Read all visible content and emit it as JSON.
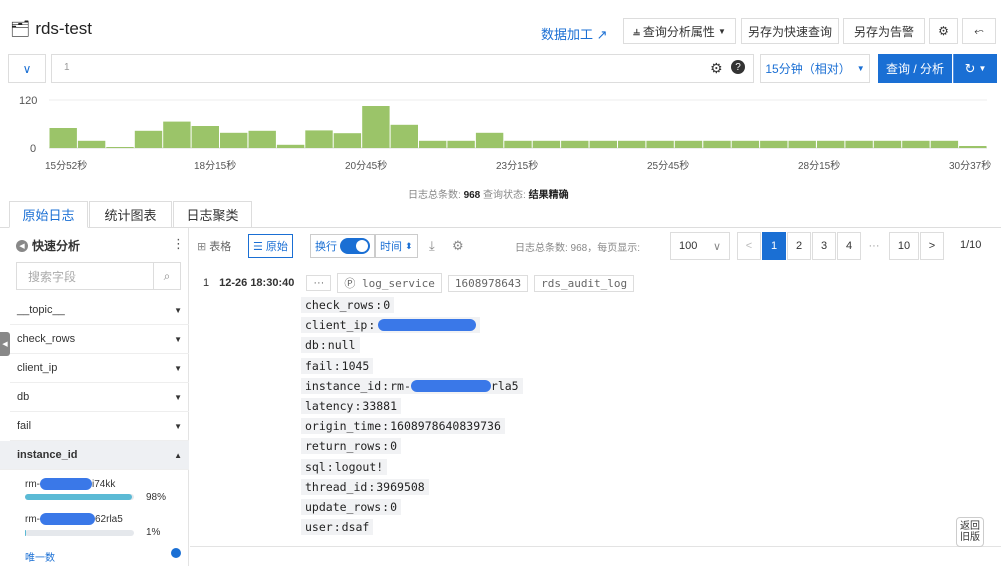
{
  "header": {
    "title": "rds-test",
    "data_processing": "数据加工",
    "query_props": "查询分析属性",
    "save_quick": "另存为快速查询",
    "save_alert": "另存为告警"
  },
  "query": {
    "line_number": "1",
    "time_range": "15分钟（相对）",
    "query_button": "查询 / 分析"
  },
  "chart_data": {
    "type": "bar",
    "ylim": [
      0,
      120
    ],
    "yticks": [
      "120",
      "0"
    ],
    "xticks": [
      "15分52秒",
      "18分15秒",
      "20分45秒",
      "23分15秒",
      "25分45秒",
      "28分15秒",
      "30分37秒"
    ],
    "values": [
      50,
      18,
      2,
      43,
      66,
      55,
      38,
      43,
      8,
      44,
      37,
      105,
      58,
      18,
      18,
      38,
      18,
      18,
      18,
      18,
      18,
      18,
      18,
      18,
      18,
      18,
      18,
      18,
      18,
      18,
      18,
      18,
      5
    ],
    "color": "#9bc469"
  },
  "summary": {
    "prefix": "日志总条数:",
    "count": "968",
    "status_label": "查询状态:",
    "status": "结果精确"
  },
  "tabs": [
    "原始日志",
    "统计图表",
    "日志聚类"
  ],
  "sidebar": {
    "title": "快速分析",
    "search_placeholder": "搜索字段",
    "fields": [
      "__topic__",
      "check_rows",
      "client_ip",
      "db",
      "fail",
      "instance_id"
    ],
    "dist": [
      {
        "prefix": "rm-",
        "suffix": "i74kk",
        "pct": "98%",
        "ratio": 0.98
      },
      {
        "prefix": "rm-",
        "suffix": "62rla5",
        "pct": "1%",
        "ratio": 0.01
      }
    ],
    "bottom_label": "唯一数"
  },
  "toolbar": {
    "table": "表格",
    "raw": "原始",
    "wrap": "换行",
    "time": "时间",
    "page_info": "日志总条数: 968，每页显示:",
    "page_size": "100",
    "pages": [
      "1",
      "2",
      "3",
      "4",
      "···",
      "10"
    ],
    "page_status": "1/10"
  },
  "log": {
    "index": "1",
    "time": "12-26 18:30:40",
    "more": "···",
    "source": "log_service",
    "id": "1608978643",
    "store": "rds_audit_log",
    "fields": [
      {
        "k": "check_rows",
        "v": "0"
      },
      {
        "k": "client_ip",
        "v": ""
      },
      {
        "k": "db",
        "v": "null"
      },
      {
        "k": "fail",
        "v": "1045"
      },
      {
        "k": "instance_id",
        "v": "rm-",
        "v2": "rla5"
      },
      {
        "k": "latency",
        "v": "33881"
      },
      {
        "k": "origin_time",
        "v": "1608978640839736"
      },
      {
        "k": "return_rows",
        "v": "0"
      },
      {
        "k": "sql",
        "v": "logout!"
      },
      {
        "k": "thread_id",
        "v": "3969508"
      },
      {
        "k": "update_rows",
        "v": "0"
      },
      {
        "k": "user",
        "v": "dsaf"
      }
    ]
  },
  "old_version": "返回旧版"
}
